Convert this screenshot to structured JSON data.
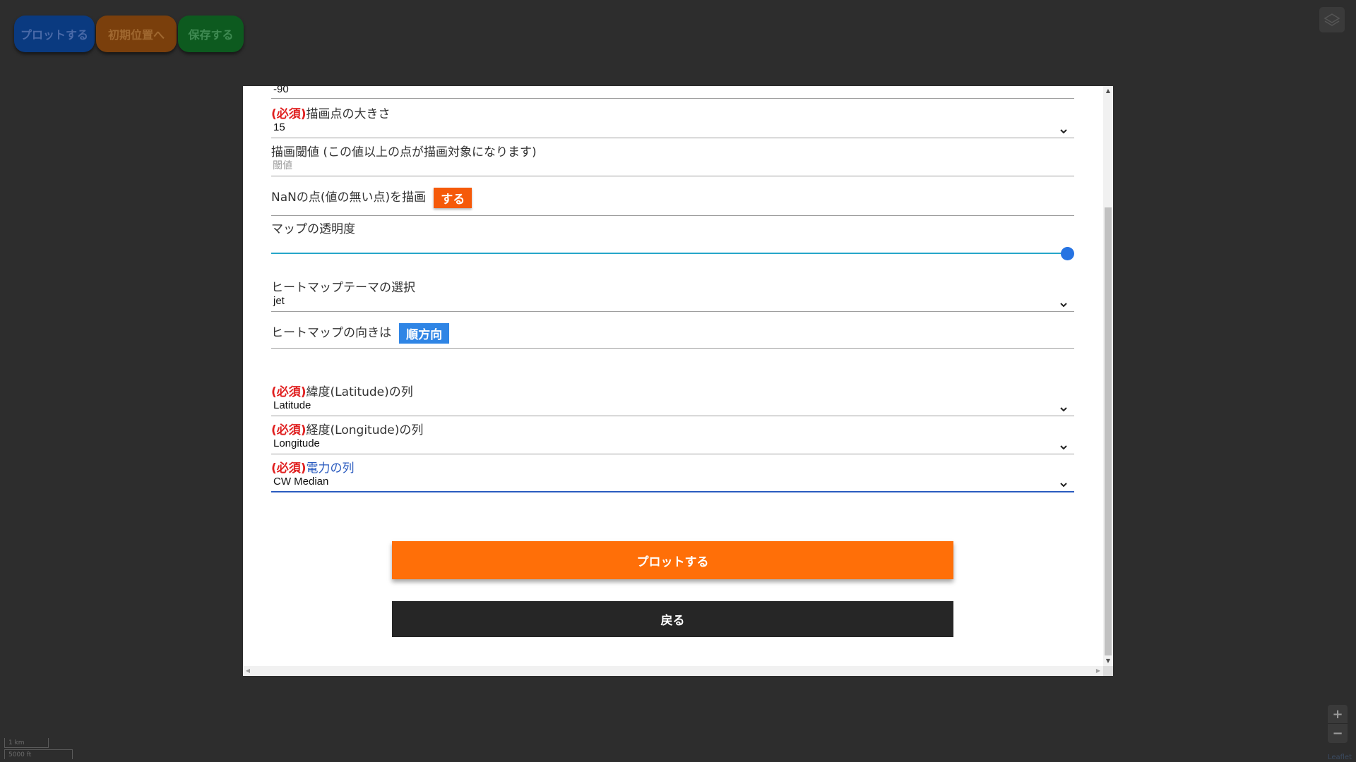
{
  "map_buttons": {
    "plot": "プロットする",
    "home": "初期位置へ",
    "save": "保存する"
  },
  "map_controls": {
    "zoom_in": "+",
    "zoom_out": "−",
    "attribution": "Leaflet",
    "scale_km": "1 km",
    "scale_ft": "5000 ft"
  },
  "form": {
    "top_value": "-90",
    "required_tag": "(必須)",
    "point_size": {
      "label": "描画点の大きさ",
      "value": "15"
    },
    "threshold": {
      "label": "描画閾値 (この値以上の点が描画対象になります)",
      "placeholder": "閾値"
    },
    "nan_draw": {
      "label": "NaNの点(値の無い点)を描画",
      "toggle": "する"
    },
    "map_opacity": {
      "label": "マップの透明度",
      "level": 1.0
    },
    "heatmap_theme": {
      "label": "ヒートマップテーマの選択",
      "value": "jet"
    },
    "heatmap_direction": {
      "label": "ヒートマップの向きは",
      "toggle": "順方向"
    },
    "lat_col": {
      "label": "緯度(Latitude)の列",
      "value": "Latitude"
    },
    "lon_col": {
      "label": "経度(Longitude)の列",
      "value": "Longitude"
    },
    "power_col": {
      "label": "電力の列",
      "value": "CW Median"
    },
    "plot_button": "プロットする",
    "back_button": "戻る"
  },
  "colors": {
    "accent_orange": "#ff6f08",
    "accent_blue": "#2f85e5",
    "required_red": "#e02020"
  }
}
